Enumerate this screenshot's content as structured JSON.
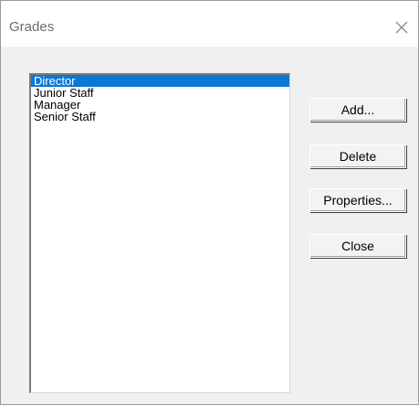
{
  "window": {
    "title": "Grades",
    "close_icon": "close-icon"
  },
  "grades_list": {
    "items": [
      "Director",
      "Junior Staff",
      "Manager",
      "Senior Staff"
    ],
    "selected_item": "Director"
  },
  "buttons": {
    "add": "Add...",
    "delete": "Delete",
    "properties": "Properties...",
    "close": "Close"
  },
  "colors": {
    "selection_background": "#0a78d7",
    "selection_text": "#ffffff",
    "dialog_background": "#f0f0f0"
  }
}
